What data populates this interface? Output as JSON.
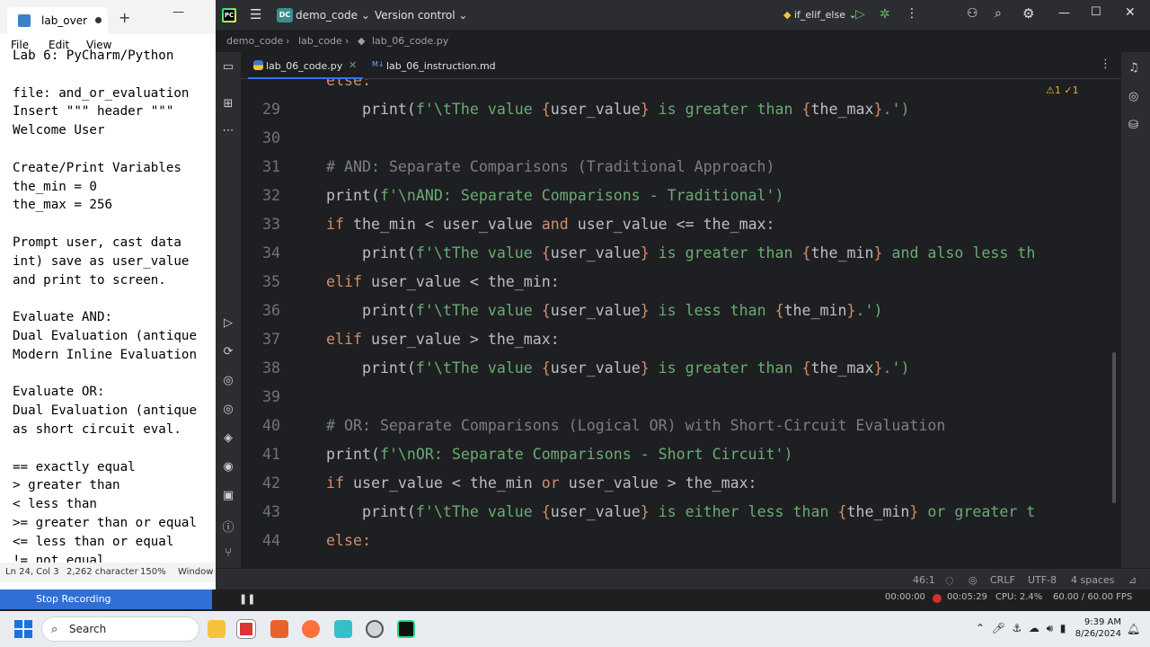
{
  "notepad": {
    "tab_title": "lab_over",
    "menu": [
      "File",
      "Edit",
      "View"
    ],
    "lines": [
      "Lab 6: PyCharm/Python",
      "",
      "file: and_or_evaluation",
      "Insert \"\"\" header \"\"\"",
      "Welcome User",
      "",
      "Create/Print Variables",
      "the_min = 0",
      "the_max = 256",
      "",
      "Prompt user, cast data",
      "int) save as user_value",
      "and print to screen.",
      "",
      "Evaluate AND:",
      "Dual Evaluation (antique",
      "Modern Inline Evaluation",
      "",
      "Evaluate OR:",
      "Dual Evaluation (antique",
      "as short circuit eval.",
      "",
      "== exactly equal",
      "> greater than",
      "< less than",
      ">= greater than or equal",
      "<= less than or equal",
      "!= not equal"
    ],
    "status": {
      "position": "Ln 24, Col 3",
      "chars": "2,262 character",
      "zoom": "150%",
      "eol": "Window"
    }
  },
  "recording": {
    "stop_label": "Stop Recording",
    "time1": "00:00:00",
    "time2": "00:05:29",
    "cpu": "CPU: 2.4%",
    "fps": "60.00 / 60.00 FPS"
  },
  "taskbar": {
    "search_label": "Search",
    "time": "9:39 AM",
    "date": "8/26/2024"
  },
  "ide": {
    "project_badge": "DC",
    "project_name": "demo_code",
    "vcs_label": "Version control",
    "run_config": "if_elif_else",
    "breadcrumbs": [
      "demo_code",
      "lab_code",
      "lab_06_code.py"
    ],
    "tabs": [
      "lab_06_code.py",
      "lab_06_instruction.md"
    ],
    "inspect": "⚠1  ✓1",
    "status": {
      "position": "46:1",
      "eol": "CRLF",
      "encoding": "UTF-8",
      "indent": "4 spaces"
    },
    "lines": [
      {
        "n": "",
        "segs": [
          {
            "t": "else:",
            "c": "kw"
          }
        ]
      },
      {
        "n": "29",
        "segs": [
          {
            "t": "    print(",
            "c": ""
          },
          {
            "t": "f'\\tThe value ",
            "c": "str"
          },
          {
            "t": "{",
            "c": "br"
          },
          {
            "t": "user_value",
            "c": "iv"
          },
          {
            "t": "}",
            "c": "br"
          },
          {
            "t": " is greater than ",
            "c": "str"
          },
          {
            "t": "{",
            "c": "br"
          },
          {
            "t": "the_max",
            "c": "iv"
          },
          {
            "t": "}",
            "c": "br"
          },
          {
            "t": ".')",
            "c": "str"
          }
        ]
      },
      {
        "n": "30",
        "segs": []
      },
      {
        "n": "31",
        "segs": [
          {
            "t": "# AND: Separate Comparisons (Traditional Approach)",
            "c": "cm"
          }
        ]
      },
      {
        "n": "32",
        "segs": [
          {
            "t": "print(",
            "c": ""
          },
          {
            "t": "f'\\nAND: Separate Comparisons - Traditional')",
            "c": "str"
          }
        ]
      },
      {
        "n": "33",
        "segs": [
          {
            "t": "if ",
            "c": "kw"
          },
          {
            "t": "the_min < user_value ",
            "c": ""
          },
          {
            "t": "and",
            "c": "kw"
          },
          {
            "t": " user_value <= the_max:",
            "c": ""
          }
        ]
      },
      {
        "n": "34",
        "segs": [
          {
            "t": "    print(",
            "c": ""
          },
          {
            "t": "f'\\tThe value ",
            "c": "str"
          },
          {
            "t": "{",
            "c": "br"
          },
          {
            "t": "user_value",
            "c": "iv"
          },
          {
            "t": "}",
            "c": "br"
          },
          {
            "t": " is greater than ",
            "c": "str"
          },
          {
            "t": "{",
            "c": "br"
          },
          {
            "t": "the_min",
            "c": "iv"
          },
          {
            "t": "}",
            "c": "br"
          },
          {
            "t": " and also less th",
            "c": "str"
          }
        ]
      },
      {
        "n": "35",
        "segs": [
          {
            "t": "elif ",
            "c": "kw"
          },
          {
            "t": "user_value < the_min:",
            "c": ""
          }
        ]
      },
      {
        "n": "36",
        "segs": [
          {
            "t": "    print(",
            "c": ""
          },
          {
            "t": "f'\\tThe value ",
            "c": "str"
          },
          {
            "t": "{",
            "c": "br"
          },
          {
            "t": "user_value",
            "c": "iv"
          },
          {
            "t": "}",
            "c": "br"
          },
          {
            "t": " is less than ",
            "c": "str"
          },
          {
            "t": "{",
            "c": "br"
          },
          {
            "t": "the_min",
            "c": "iv"
          },
          {
            "t": "}",
            "c": "br"
          },
          {
            "t": ".')",
            "c": "str"
          }
        ]
      },
      {
        "n": "37",
        "segs": [
          {
            "t": "elif ",
            "c": "kw"
          },
          {
            "t": "user_value > the_max:",
            "c": ""
          }
        ]
      },
      {
        "n": "38",
        "segs": [
          {
            "t": "    print(",
            "c": ""
          },
          {
            "t": "f'\\tThe value ",
            "c": "str"
          },
          {
            "t": "{",
            "c": "br"
          },
          {
            "t": "user_value",
            "c": "iv"
          },
          {
            "t": "}",
            "c": "br"
          },
          {
            "t": " is greater than ",
            "c": "str"
          },
          {
            "t": "{",
            "c": "br"
          },
          {
            "t": "the_max",
            "c": "iv"
          },
          {
            "t": "}",
            "c": "br"
          },
          {
            "t": ".')",
            "c": "str"
          }
        ]
      },
      {
        "n": "39",
        "segs": []
      },
      {
        "n": "40",
        "segs": [
          {
            "t": "# OR: Separate Comparisons (Logical OR) with Short-Circuit Evaluation",
            "c": "cm"
          }
        ]
      },
      {
        "n": "41",
        "segs": [
          {
            "t": "print(",
            "c": ""
          },
          {
            "t": "f'\\nOR: Separate Comparisons - Short Circuit')",
            "c": "str"
          }
        ]
      },
      {
        "n": "42",
        "segs": [
          {
            "t": "if ",
            "c": "kw"
          },
          {
            "t": "user_value < the_min ",
            "c": ""
          },
          {
            "t": "or",
            "c": "kw"
          },
          {
            "t": " user_value > the_max:",
            "c": ""
          }
        ]
      },
      {
        "n": "43",
        "segs": [
          {
            "t": "    print(",
            "c": ""
          },
          {
            "t": "f'\\tThe value ",
            "c": "str"
          },
          {
            "t": "{",
            "c": "br"
          },
          {
            "t": "user_value",
            "c": "iv"
          },
          {
            "t": "}",
            "c": "br"
          },
          {
            "t": " is either less than ",
            "c": "str"
          },
          {
            "t": "{",
            "c": "br"
          },
          {
            "t": "the_min",
            "c": "iv"
          },
          {
            "t": "}",
            "c": "br"
          },
          {
            "t": " or greater t",
            "c": "str"
          }
        ]
      },
      {
        "n": "44",
        "segs": [
          {
            "t": "else:",
            "c": "kw"
          }
        ]
      }
    ]
  }
}
